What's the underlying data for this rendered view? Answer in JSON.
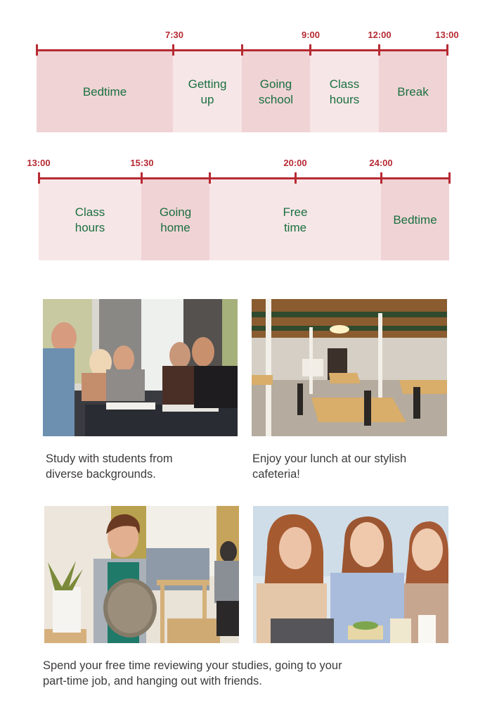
{
  "colors": {
    "timeline_accent": "#b72a33",
    "segment_dark": "#f0d3d5",
    "segment_light": "#f7e6e7",
    "segment_text": "#1a7040",
    "caption_text": "#3d3a3a"
  },
  "timelines": [
    {
      "tick_labels": [
        "",
        "7:30",
        "",
        "9:00",
        "12:00",
        "13:00"
      ],
      "segments": [
        {
          "label": "Bedtime",
          "shade": "dark"
        },
        {
          "label": "Getting\nup",
          "shade": "light"
        },
        {
          "label": "Going\nschool",
          "shade": "dark"
        },
        {
          "label": "Class\nhours",
          "shade": "light"
        },
        {
          "label": "Break",
          "shade": "dark"
        }
      ]
    },
    {
      "tick_labels": [
        "13:00",
        "15:30",
        "",
        "20:00",
        "24:00",
        ""
      ],
      "segments": [
        {
          "label": "Class\nhours",
          "shade": "light"
        },
        {
          "label": "Going\nhome",
          "shade": "dark"
        },
        {
          "label": "Free\ntime",
          "shade": "light"
        },
        {
          "label": "Bedtime",
          "shade": "dark"
        }
      ]
    }
  ],
  "photos": [
    {
      "description": "Students studying together at a table"
    },
    {
      "description": "Stylish cafeteria with wooden tables"
    },
    {
      "description": "Smiling waitress holding a tray at part-time job"
    },
    {
      "description": "Three friends eating together"
    }
  ],
  "captions": {
    "study": "Study with students from\ndiverse backgrounds.",
    "cafeteria": "Enjoy your lunch at our stylish\ncafeteria!",
    "free_time": "Spend your free time reviewing your studies, going to your\npart-time job, and hanging out with friends."
  }
}
